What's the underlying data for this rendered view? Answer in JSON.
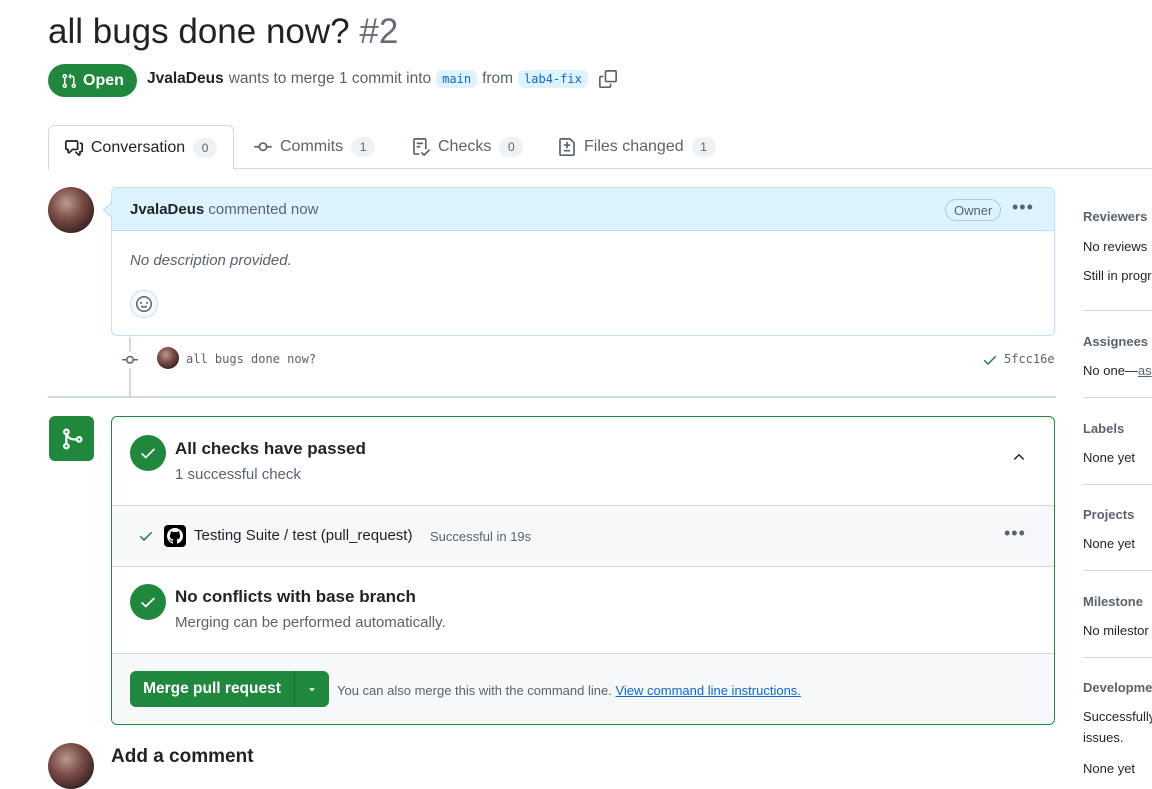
{
  "pr": {
    "title": "all bugs done now?",
    "number": "#2",
    "status": "Open",
    "author": "JvalaDeus",
    "merge_text": "wants to merge 1 commit into",
    "base_branch": "main",
    "from_text": "from",
    "head_branch": "lab4-fix"
  },
  "tabs": [
    {
      "label": "Conversation",
      "count": "0",
      "icon": "comment-discussion-icon"
    },
    {
      "label": "Commits",
      "count": "1",
      "icon": "git-commit-icon"
    },
    {
      "label": "Checks",
      "count": "0",
      "icon": "checklist-icon"
    },
    {
      "label": "Files changed",
      "count": "1",
      "icon": "file-diff-icon"
    }
  ],
  "comment": {
    "author": "JvalaDeus",
    "action": "commented now",
    "badge": "Owner",
    "body": "No description provided."
  },
  "commit": {
    "message": "all bugs done now?",
    "sha": "5fcc16e"
  },
  "checks": {
    "title": "All checks have passed",
    "subtitle": "1 successful check",
    "run_name": "Testing Suite / test (pull_request)",
    "run_status": "Successful in 19s",
    "conflicts_title": "No conflicts with base branch",
    "conflicts_sub": "Merging can be performed automatically.",
    "merge_button": "Merge pull request",
    "cli_text": "You can also merge this with the command line.",
    "cli_link": "View command line instructions."
  },
  "add_comment": "Add a comment",
  "sidebar": {
    "reviewers_label": "Reviewers",
    "reviewers_value": "No reviews",
    "reviewers_sub": "Still in progr",
    "assignees_label": "Assignees",
    "assignees_value": "No one—",
    "assignees_link": "as",
    "labels_label": "Labels",
    "labels_value": "None yet",
    "projects_label": "Projects",
    "projects_value": "None yet",
    "milestone_label": "Milestone",
    "milestone_value": "No milestor",
    "development_label": "Developme",
    "development_value_1": "Successfully",
    "development_value_2": "issues.",
    "development_value_3": "None yet"
  },
  "colors": {
    "accent_green": "#1f883d",
    "link_blue": "#0969da",
    "comment_header_bg": "#ddf4ff"
  }
}
